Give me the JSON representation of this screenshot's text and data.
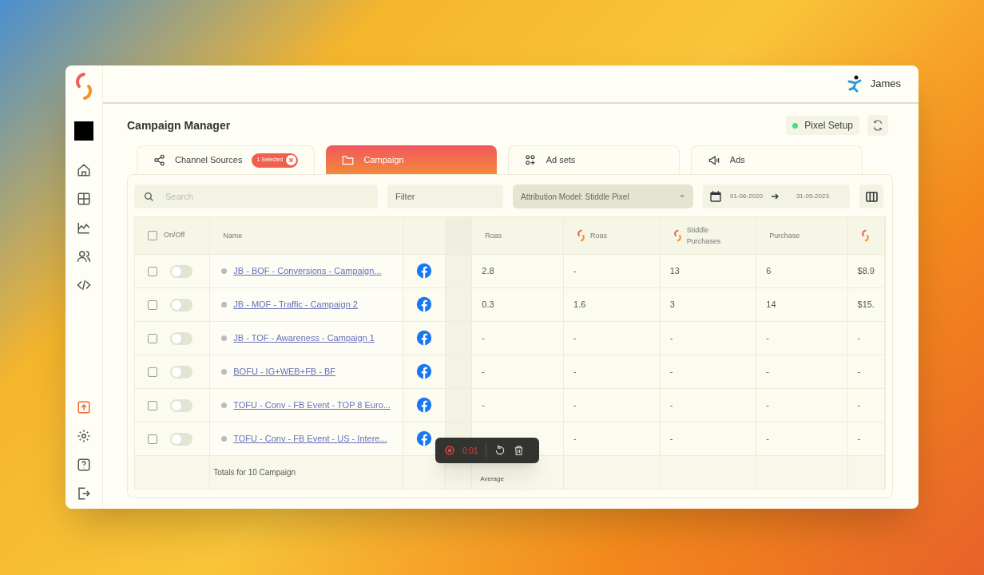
{
  "header": {
    "user_name": "James"
  },
  "page": {
    "title": "Campaign Manager",
    "pixel_setup": {
      "label": "Pixel Setup",
      "color": "#4ade80"
    }
  },
  "tabs": [
    {
      "label": "Channel Sources",
      "selected": false,
      "badge": "1 Selected"
    },
    {
      "label": "Campaign",
      "selected": true
    },
    {
      "label": "Ad sets",
      "selected": false
    },
    {
      "label": "Ads",
      "selected": false
    }
  ],
  "toolbar": {
    "search_placeholder": "Search",
    "filter_label": "Filter",
    "attribution": "Attribution Model: Stiddle Pixel",
    "date_from": "01-06-2020",
    "date_to": "31-05-2023"
  },
  "table": {
    "all_selected": false,
    "columns": [
      {
        "kind": "select",
        "label": "On/Off"
      },
      {
        "kind": "name",
        "label": "Name"
      },
      {
        "kind": "channel"
      },
      {
        "kind": "spacer"
      },
      {
        "kind": "metric",
        "label": "Roas",
        "logo": false
      },
      {
        "kind": "metric",
        "label": "Roas",
        "logo": true
      },
      {
        "kind": "metric",
        "label": "Stiddle Purchases",
        "logo": true
      },
      {
        "kind": "metric",
        "label": "Purchase",
        "logo": false
      },
      {
        "kind": "metric",
        "logo": true
      }
    ],
    "rows": [
      {
        "selected": false,
        "on": false,
        "name": "JB - BOF - Conversions - Campaign...",
        "metrics": {
          "column_5": "2.8",
          "column_6": "-",
          "column_7": "13",
          "column_8": "6",
          "column_9": "$8.9"
        }
      },
      {
        "selected": false,
        "on": false,
        "name": "JB - MOF - Traffic - Campaign 2",
        "metrics": {
          "column_5": "0.3",
          "column_6": "1.6",
          "column_7": "3",
          "column_8": "14",
          "column_9": "$15."
        }
      },
      {
        "selected": false,
        "on": false,
        "name": "JB - TOF - Awareness - Campaign 1",
        "metrics": {
          "column_5": "-",
          "column_6": "-",
          "column_7": "-",
          "column_8": "-",
          "column_9": "-"
        }
      },
      {
        "selected": false,
        "on": false,
        "name": "BOFU - IG+WEB+FB - BF",
        "metrics": {
          "column_5": "-",
          "column_6": "-",
          "column_7": "-",
          "column_8": "-",
          "column_9": "-"
        }
      },
      {
        "selected": false,
        "on": false,
        "name": "TOFU - Conv - FB Event - TOP 8 Euro...",
        "metrics": {
          "column_5": "-",
          "column_6": "-",
          "column_7": "-",
          "column_8": "-",
          "column_9": "-"
        }
      },
      {
        "selected": false,
        "on": false,
        "name": "TOFU - Conv - FB Event - US - Intere...",
        "metrics": {
          "column_6": "-",
          "column_7": "-",
          "column_8": "-",
          "column_9": "-"
        }
      }
    ],
    "totals": {
      "label": "Totals for 10 Campaign",
      "average_label": "Average"
    }
  },
  "recorder": {
    "time": "0:01"
  }
}
